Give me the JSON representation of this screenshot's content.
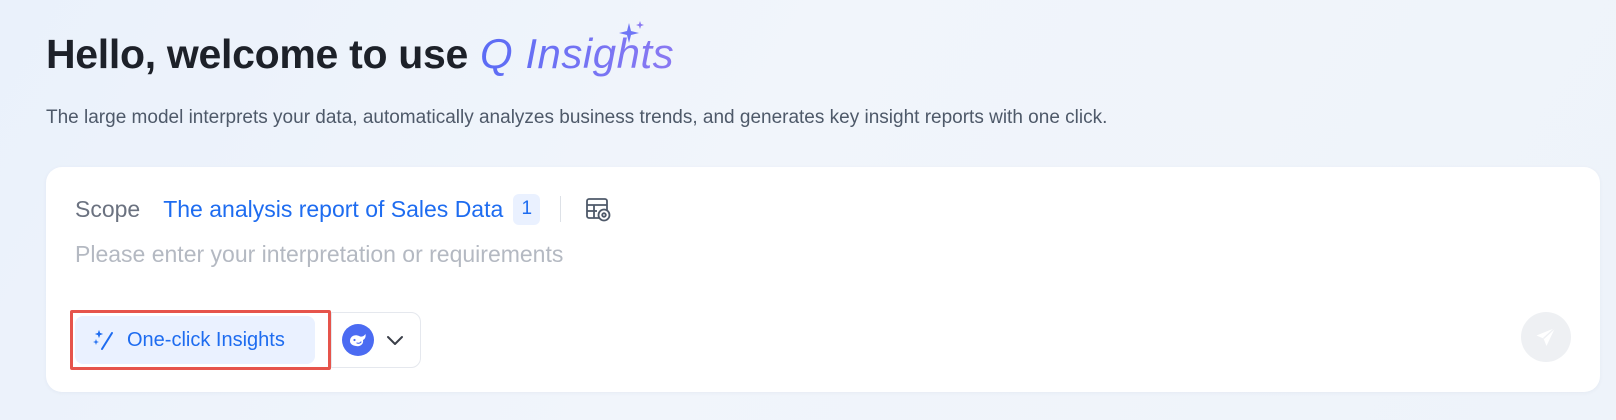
{
  "header": {
    "greeting": "Hello, welcome to use",
    "brand": "Q Insights",
    "subtitle": "The large model interprets your data, automatically analyzes business trends, and generates key insight reports with one click."
  },
  "card": {
    "scope": {
      "label": "Scope",
      "value": "The analysis report of Sales Data",
      "count": "1",
      "settings_icon": "table-settings-icon"
    },
    "input": {
      "placeholder": "Please enter your interpretation or requirements",
      "value": ""
    },
    "actions": {
      "one_click": {
        "label": "One-click Insights",
        "icon": "magic-wand-icon",
        "highlighted": true
      },
      "model_select": {
        "icon": "whale-model-icon",
        "dropdown_icon": "chevron-down-icon"
      },
      "send": {
        "icon": "paper-plane-icon",
        "enabled": false
      }
    }
  },
  "colors": {
    "accent": "#1e6cf0",
    "brand_start": "#5b6cf5",
    "brand_end": "#8a79f2",
    "highlight": "#e6544b",
    "model_avatar": "#4b6bf2"
  }
}
